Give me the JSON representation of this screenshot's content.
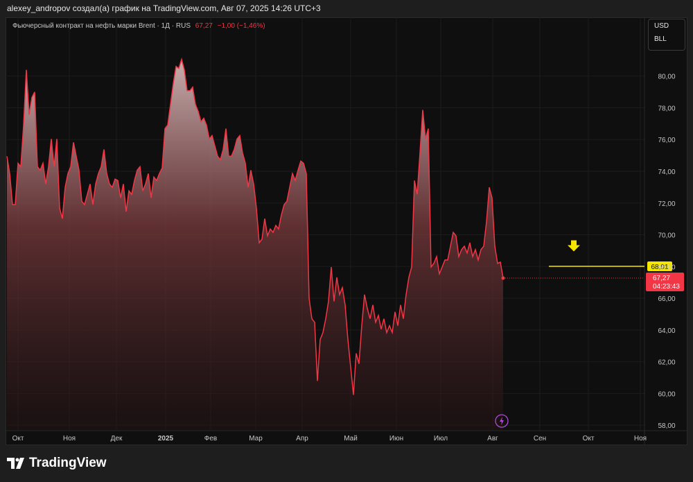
{
  "header": {
    "credit": "alexey_andropov создал(а) график на TradingView.com, Авг 07, 2025 14:26 UTC+3"
  },
  "legend": {
    "symbol": "Фьючерсный контракт на нефть марки Brent · 1Д · RUS",
    "price": "67,27",
    "change": "−1,00 (−1,46%)"
  },
  "units": {
    "currency": "USD",
    "unit": "BLL"
  },
  "footer": {
    "logo_text": "TradingView"
  },
  "colors": {
    "line": "#f23645",
    "annotation": "#f5e600",
    "background": "#0f0f0f"
  },
  "chart_data": {
    "type": "area",
    "title": "Фьючерсный контракт на нефть марки Brent · 1Д",
    "ylim": [
      57.7,
      83.7
    ],
    "xlim": [
      0,
      230
    ],
    "y_ticks": [
      58,
      60,
      62,
      64,
      66,
      68,
      70,
      72,
      74,
      76,
      78,
      80
    ],
    "y_tick_labels": [
      "58,00",
      "60,00",
      "62,00",
      "64,00",
      "66,00",
      "68,00",
      "70,00",
      "72,00",
      "74,00",
      "76,00",
      "78,00",
      "80,00"
    ],
    "x_ticks": [
      4,
      22.5,
      39.5,
      57.25,
      73.5,
      89.75,
      106.5,
      124,
      140.5,
      156.5,
      175.25,
      192.25,
      209.75,
      228.5
    ],
    "x_tick_labels": [
      "Окт",
      "Ноя",
      "Дек",
      "2025",
      "Фев",
      "Мар",
      "Апр",
      "Май",
      "Июн",
      "Июл",
      "Авг",
      "Сен",
      "Окт",
      "Ноя"
    ],
    "values": [
      74.95,
      73.86,
      71.9,
      71.9,
      74.51,
      74.29,
      76.91,
      80.39,
      77.56,
      78.65,
      79.0,
      74.29,
      74.07,
      74.51,
      73.2,
      74.29,
      76.04,
      74.29,
      76.04,
      71.68,
      71.02,
      72.99,
      73.86,
      74.29,
      75.82,
      74.95,
      74.07,
      72.11,
      71.9,
      72.55,
      73.2,
      71.9,
      73.2,
      73.86,
      74.29,
      75.38,
      73.86,
      73.2,
      72.99,
      73.51,
      73.42,
      72.33,
      73.2,
      71.46,
      72.77,
      72.55,
      73.42,
      74.07,
      74.29,
      72.77,
      73.2,
      73.86,
      72.33,
      73.64,
      73.42,
      73.86,
      74.21,
      76.69,
      76.91,
      78.21,
      79.52,
      80.61,
      80.48,
      81.05,
      80.39,
      79.08,
      79.08,
      79.3,
      78.21,
      77.78,
      77.12,
      77.34,
      76.91,
      76.04,
      76.25,
      75.6,
      74.95,
      74.73,
      75.38,
      76.69,
      74.95,
      74.95,
      75.38,
      76.04,
      76.25,
      75.16,
      74.51,
      72.99,
      74.07,
      73.2,
      71.68,
      69.5,
      69.72,
      71.02,
      69.94,
      70.37,
      70.15,
      70.59,
      70.37,
      71.24,
      71.9,
      72.11,
      72.99,
      73.86,
      73.42,
      74.07,
      74.64,
      74.51,
      73.86,
      66.01,
      64.71,
      64.49,
      60.79,
      63.4,
      63.84,
      64.71,
      65.8,
      67.97,
      65.8,
      67.32,
      66.23,
      66.67,
      65.58,
      63.4,
      61.66,
      59.91,
      62.53,
      61.87,
      64.27,
      66.23,
      65.36,
      64.71,
      65.58,
      64.49,
      64.92,
      64.05,
      64.71,
      63.84,
      64.27,
      63.84,
      65.14,
      64.27,
      65.58,
      64.71,
      66.23,
      67.32,
      67.97,
      73.42,
      72.55,
      75.16,
      77.87,
      76.04,
      76.69,
      67.97,
      68.19,
      68.63,
      67.54,
      67.97,
      68.41,
      68.41,
      69.28,
      70.15,
      69.94,
      68.63,
      69.06,
      69.28,
      68.85,
      69.5,
      68.63,
      69.06,
      68.41,
      69.06,
      69.28,
      70.81,
      72.99,
      72.33,
      69.28,
      68.19,
      68.28,
      67.27
    ],
    "last_price": {
      "value": 67.27,
      "label": "67,27",
      "countdown": "04:23:43"
    },
    "annotations": [
      {
        "type": "horizontal-line",
        "value": 68.01,
        "label": "68,01"
      },
      {
        "type": "arrow-down",
        "value": 69.3
      }
    ],
    "grid": true
  }
}
